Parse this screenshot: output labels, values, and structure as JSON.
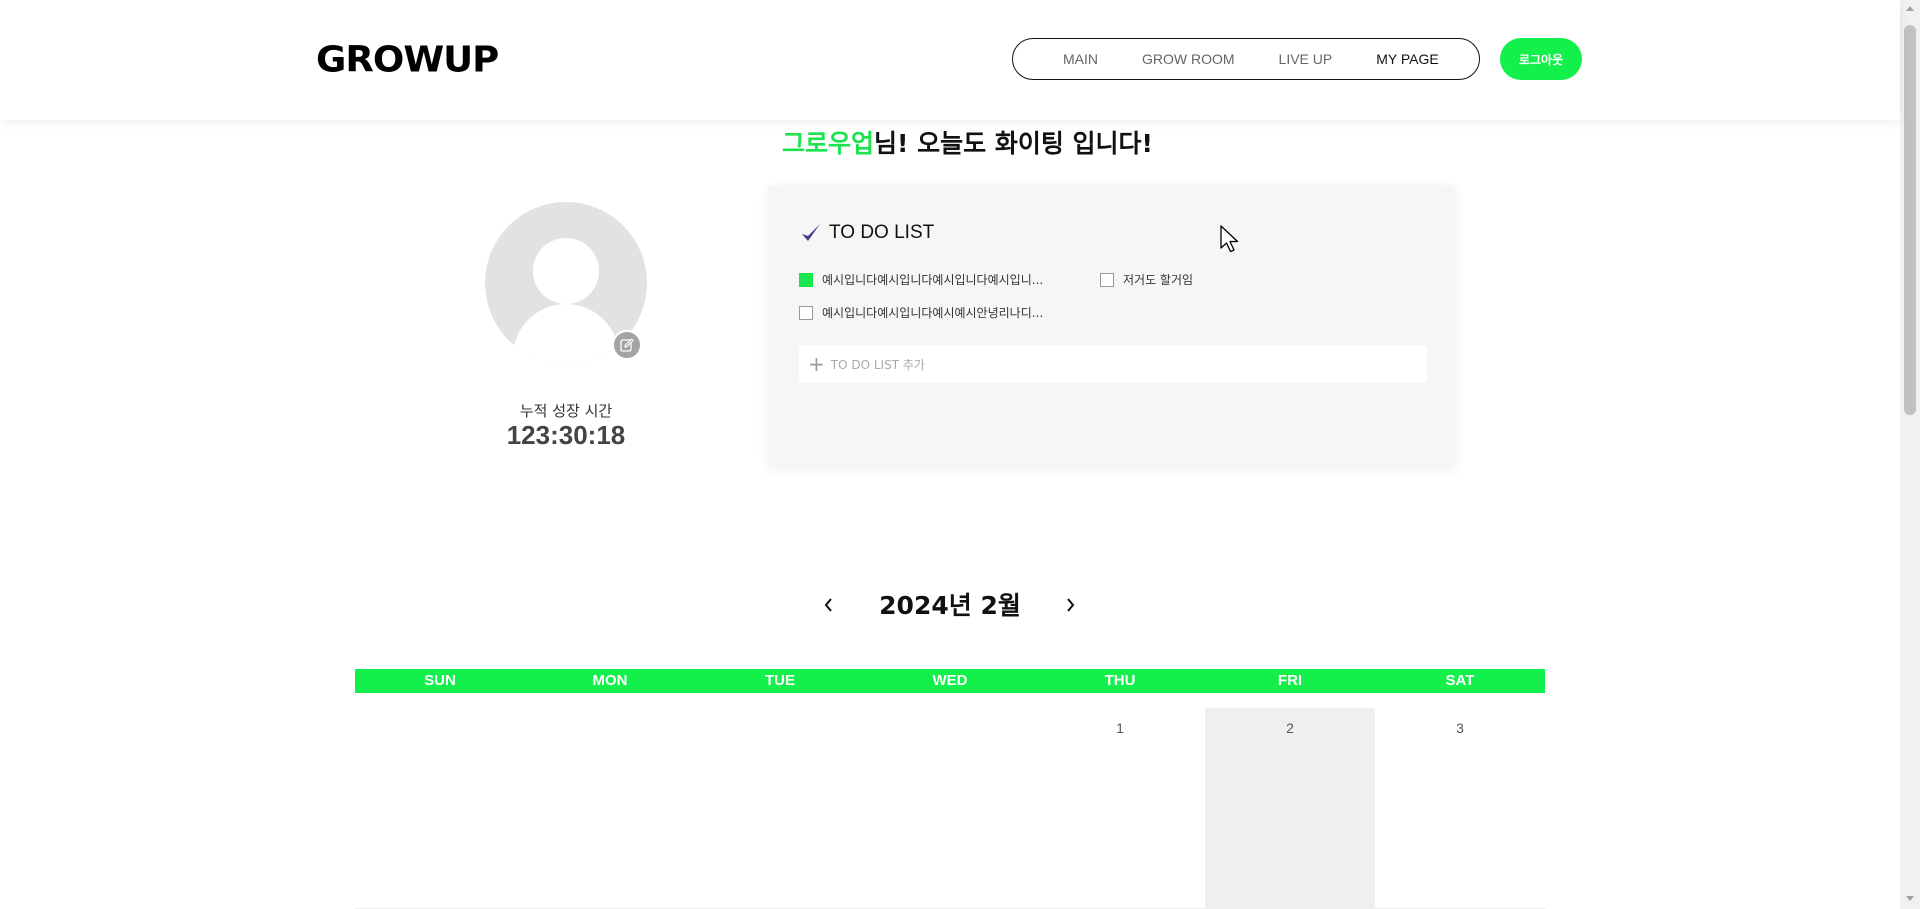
{
  "header": {
    "logo": "GROWUP",
    "nav": [
      "MAIN",
      "GROW ROOM",
      "LIVE UP",
      "MY PAGE"
    ],
    "active_nav": "MY PAGE",
    "logout_label": "로그아웃"
  },
  "greeting": {
    "name": "그로우업",
    "message": "님! 오늘도 화이팅 입니다!"
  },
  "profile": {
    "edit_icon": "edit-icon",
    "stat_label": "누적 성장 시간",
    "stat_value": "123:30:18"
  },
  "todo": {
    "title": "TO DO LIST",
    "items": [
      {
        "text": "예시입니다예시입니다예시입니다예시입니...",
        "checked": true
      },
      {
        "text": "저거도 할거임",
        "checked": false
      },
      {
        "text": "예시입니다예시입니다예시예시안녕리나디...",
        "checked": false
      }
    ],
    "add_placeholder": "TO DO LIST 추가"
  },
  "calendar": {
    "title": "2024년 2월",
    "weekdays": [
      "SUN",
      "MON",
      "TUE",
      "WED",
      "THU",
      "FRI",
      "SAT"
    ],
    "first_week": [
      "",
      "",
      "",
      "",
      "1",
      "2",
      "3"
    ],
    "today": "2"
  },
  "colors": {
    "accent": "#14f04b",
    "greeting_name": "#1de34e",
    "checkmark": "#4b3a8c"
  }
}
